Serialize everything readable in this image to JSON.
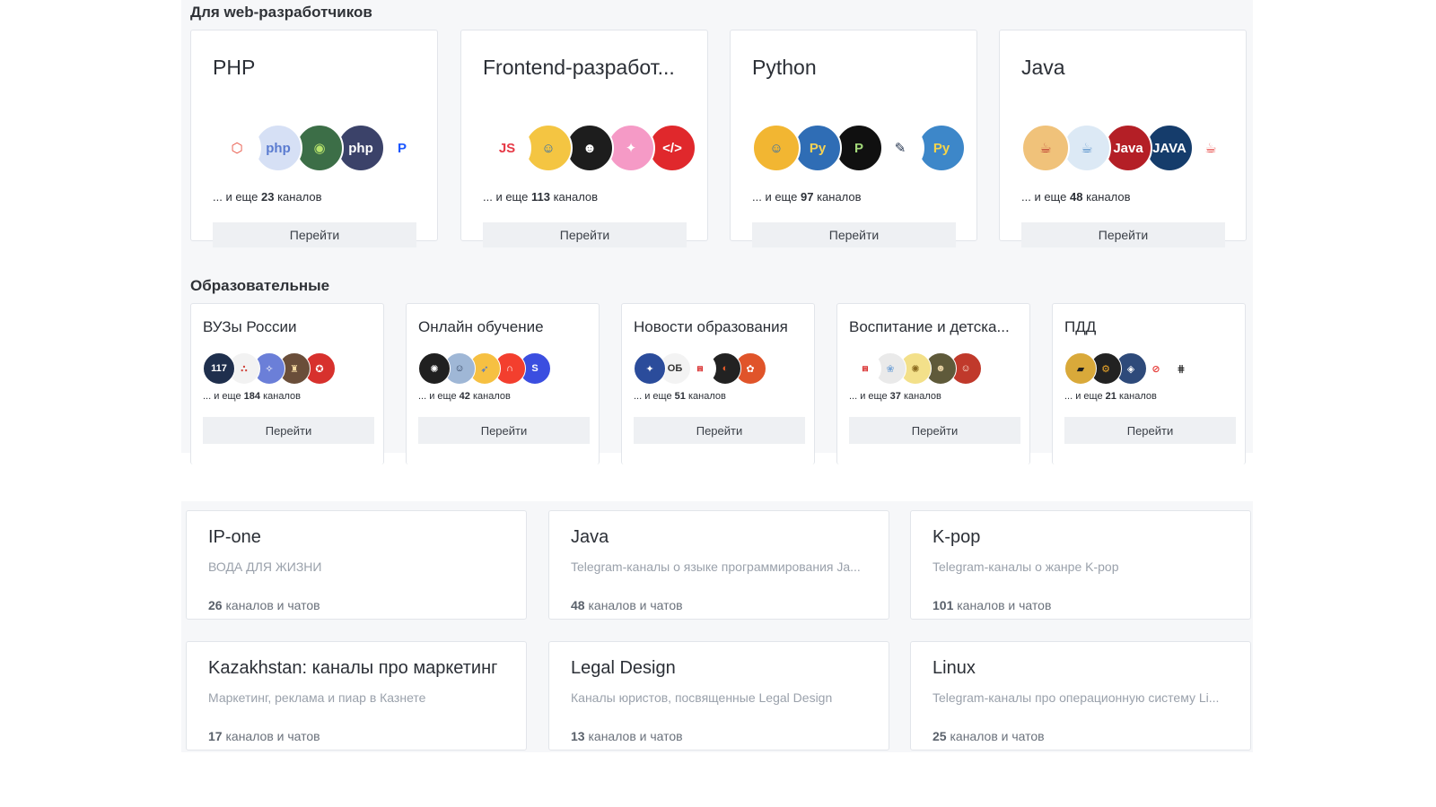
{
  "section_web": {
    "title": "Для web-разработчиков",
    "cards": [
      {
        "title": "PHP",
        "more_prefix": "... и еще",
        "more_count": "23",
        "more_suffix": "каналов",
        "button": "Перейти",
        "avatars": [
          {
            "icon": "laravel-logo",
            "text": "⬡",
            "color": "#ffffff",
            "fg": "#e74c3c"
          },
          {
            "icon": "php-logo",
            "text": "php",
            "color": "#d6e0f5",
            "fg": "#5a7bd0"
          },
          {
            "icon": "php-community-logo",
            "text": "◉",
            "color": "#3c6e47",
            "fg": "#b7e36c"
          },
          {
            "icon": "php-logo-dark",
            "text": "php",
            "color": "#3b4269",
            "fg": "#ffffff"
          },
          {
            "icon": "p-logo",
            "text": "P",
            "color": "#ffffff",
            "fg": "#1a56ff"
          }
        ]
      },
      {
        "title": "Frontend-разработ...",
        "more_prefix": "... и еще",
        "more_count": "113",
        "more_suffix": "каналов",
        "button": "Перейти",
        "avatars": [
          {
            "icon": "js-logo",
            "text": "JS",
            "color": "#ffffff",
            "fg": "#e63946"
          },
          {
            "icon": "cartoon-avatar",
            "text": "☺",
            "color": "#f4c542",
            "fg": "#2b6cb0"
          },
          {
            "icon": "bearded-man-logo",
            "text": "☻",
            "color": "#1d1d1d",
            "fg": "#ffffff"
          },
          {
            "icon": "figma-logo",
            "text": "✦",
            "color": "#f59ac6",
            "fg": "#ffffff"
          },
          {
            "icon": "code-tag-logo",
            "text": "</>",
            "color": "#e0282c",
            "fg": "#ffffff"
          }
        ]
      },
      {
        "title": "Python",
        "more_prefix": "... и еще",
        "more_count": "97",
        "more_suffix": "каналов",
        "button": "Перейти",
        "avatars": [
          {
            "icon": "cartoon-person",
            "text": "☺",
            "color": "#f2b632",
            "fg": "#2b6cb0"
          },
          {
            "icon": "python-logo",
            "text": "Py",
            "color": "#2f6db5",
            "fg": "#f7d354"
          },
          {
            "icon": "p-black-logo",
            "text": "P",
            "color": "#101010",
            "fg": "#a3d97a"
          },
          {
            "icon": "sketch-figure",
            "text": "✎",
            "color": "#ffffff",
            "fg": "#22324d"
          },
          {
            "icon": "python-logo-2",
            "text": "Py",
            "color": "#3d87c9",
            "fg": "#f5d44a"
          }
        ]
      },
      {
        "title": "Java",
        "more_prefix": "... и еще",
        "more_count": "48",
        "more_suffix": "каналов",
        "button": "Перейти",
        "avatars": [
          {
            "icon": "coffee-cup",
            "text": "☕",
            "color": "#f0c27a",
            "fg": "#b9322b"
          },
          {
            "icon": "java-logo-light",
            "text": "☕",
            "color": "#dce9f5",
            "fg": "#4a88c7"
          },
          {
            "icon": "java-logo-red",
            "text": "Java",
            "color": "#b41f26",
            "fg": "#ffffff"
          },
          {
            "icon": "java-logo-dark",
            "text": "JAVA",
            "color": "#153c6b",
            "fg": "#ffffff"
          },
          {
            "icon": "java-book",
            "text": "☕",
            "color": "#ffffff",
            "fg": "#e53935"
          }
        ]
      }
    ]
  },
  "section_edu": {
    "title": "Образовательные",
    "cards": [
      {
        "title": "ВУЗы России",
        "more_prefix": "... и еще",
        "more_count": "184",
        "more_suffix": "каналов",
        "button": "Перейти",
        "avatars": [
          {
            "icon": "117-logo",
            "text": "117",
            "color": "#1f2f4d",
            "fg": "#ffffff"
          },
          {
            "icon": "university-logo",
            "text": "∴",
            "color": "#f2f2f2",
            "fg": "#d0443a"
          },
          {
            "icon": "university-emblem",
            "text": "✧",
            "color": "#6b7fd8",
            "fg": "#ffffff"
          },
          {
            "icon": "building-photo",
            "text": "♜",
            "color": "#6a4e3a",
            "fg": "#f4d9a0"
          },
          {
            "icon": "red-emblem",
            "text": "✪",
            "color": "#d7312d",
            "fg": "#ffffff"
          }
        ]
      },
      {
        "title": "Онлайн обучение",
        "more_prefix": "... и еще",
        "more_count": "42",
        "more_suffix": "каналов",
        "button": "Перейти",
        "avatars": [
          {
            "icon": "openai-logo",
            "text": "✺",
            "color": "#202020",
            "fg": "#ffffff"
          },
          {
            "icon": "person-photo",
            "text": "☺",
            "color": "#9fb7d6",
            "fg": "#2d3e5c"
          },
          {
            "icon": "rocket-logo",
            "text": "➶",
            "color": "#f6c042",
            "fg": "#3b6fd6"
          },
          {
            "icon": "netology-logo",
            "text": "∩",
            "color": "#f33f2e",
            "fg": "#ffffff"
          },
          {
            "icon": "s-logo",
            "text": "S",
            "color": "#3b4ee0",
            "fg": "#ffffff"
          }
        ]
      },
      {
        "title": "Новости образования",
        "more_prefix": "... и еще",
        "more_count": "51",
        "more_suffix": "каналов",
        "button": "Перейти",
        "avatars": [
          {
            "icon": "russian-emblem",
            "text": "✦",
            "color": "#2b4c9b",
            "fg": "#ffffff"
          },
          {
            "icon": "obraz-logo",
            "text": "ОБ",
            "color": "#f3f3f3",
            "fg": "#333333"
          },
          {
            "icon": "arch-logo",
            "text": "⩎",
            "color": "#ffffff",
            "fg": "#d82c2c"
          },
          {
            "icon": "compass-logo",
            "text": "◐",
            "color": "#222222",
            "fg": "#e85b2a"
          },
          {
            "icon": "fox-logo",
            "text": "✿",
            "color": "#e0542a",
            "fg": "#ffffff"
          }
        ]
      },
      {
        "title": "Воспитание и детска...",
        "more_prefix": "... и еще",
        "more_count": "37",
        "more_suffix": "каналов",
        "button": "Перейти",
        "avatars": [
          {
            "icon": "arch-logo",
            "text": "⩎",
            "color": "#ffffff",
            "fg": "#d82c2c"
          },
          {
            "icon": "kids-logo",
            "text": "❀",
            "color": "#eaeaea",
            "fg": "#7aa7d8"
          },
          {
            "icon": "yellow-logo",
            "text": "✺",
            "color": "#f3e08a",
            "fg": "#8b6b1f"
          },
          {
            "icon": "family-photo",
            "text": "☻",
            "color": "#5f5a3a",
            "fg": "#e8d2a4"
          },
          {
            "icon": "woman-photo",
            "text": "☺",
            "color": "#c0392b",
            "fg": "#fff0e0"
          }
        ]
      },
      {
        "title": "ПДД",
        "more_prefix": "... и еще",
        "more_count": "21",
        "more_suffix": "каналов",
        "button": "Перейти",
        "avatars": [
          {
            "icon": "truck-logo",
            "text": "▰",
            "color": "#d9a93a",
            "fg": "#1f1f1f"
          },
          {
            "icon": "wheel-logo",
            "text": "⚙",
            "color": "#222222",
            "fg": "#f0a92a"
          },
          {
            "icon": "car-logo",
            "text": "◈",
            "color": "#2e4a7a",
            "fg": "#ffffff"
          },
          {
            "icon": "no-entry-sign",
            "text": "⊘",
            "color": "#ffffff",
            "fg": "#e53935"
          },
          {
            "icon": "gearbox-logo",
            "text": "⋕",
            "color": "#ffffff",
            "fg": "#222222"
          }
        ]
      }
    ]
  },
  "topics": [
    {
      "title": "IP-one",
      "desc": "ВОДА ДЛЯ ЖИЗНИ",
      "count": "26",
      "count_suffix": "каналов и чатов"
    },
    {
      "title": "Java",
      "desc": "Telegram-каналы о языке программирования Ja...",
      "count": "48",
      "count_suffix": "каналов и чатов"
    },
    {
      "title": "K-pop",
      "desc": "Telegram-каналы о жанре K-pop",
      "count": "101",
      "count_suffix": "каналов и чатов"
    },
    {
      "title": "Kazakhstan: каналы про маркетинг",
      "desc": "Маркетинг, реклама и пиар в Казнете",
      "count": "17",
      "count_suffix": "каналов и чатов"
    },
    {
      "title": "Legal Design",
      "desc": "Каналы юристов, посвященные Legal Design",
      "count": "13",
      "count_suffix": "каналов и чатов"
    },
    {
      "title": "Linux",
      "desc": "Telegram-каналы про операционную систему Li...",
      "count": "25",
      "count_suffix": "каналов и чатов"
    }
  ]
}
